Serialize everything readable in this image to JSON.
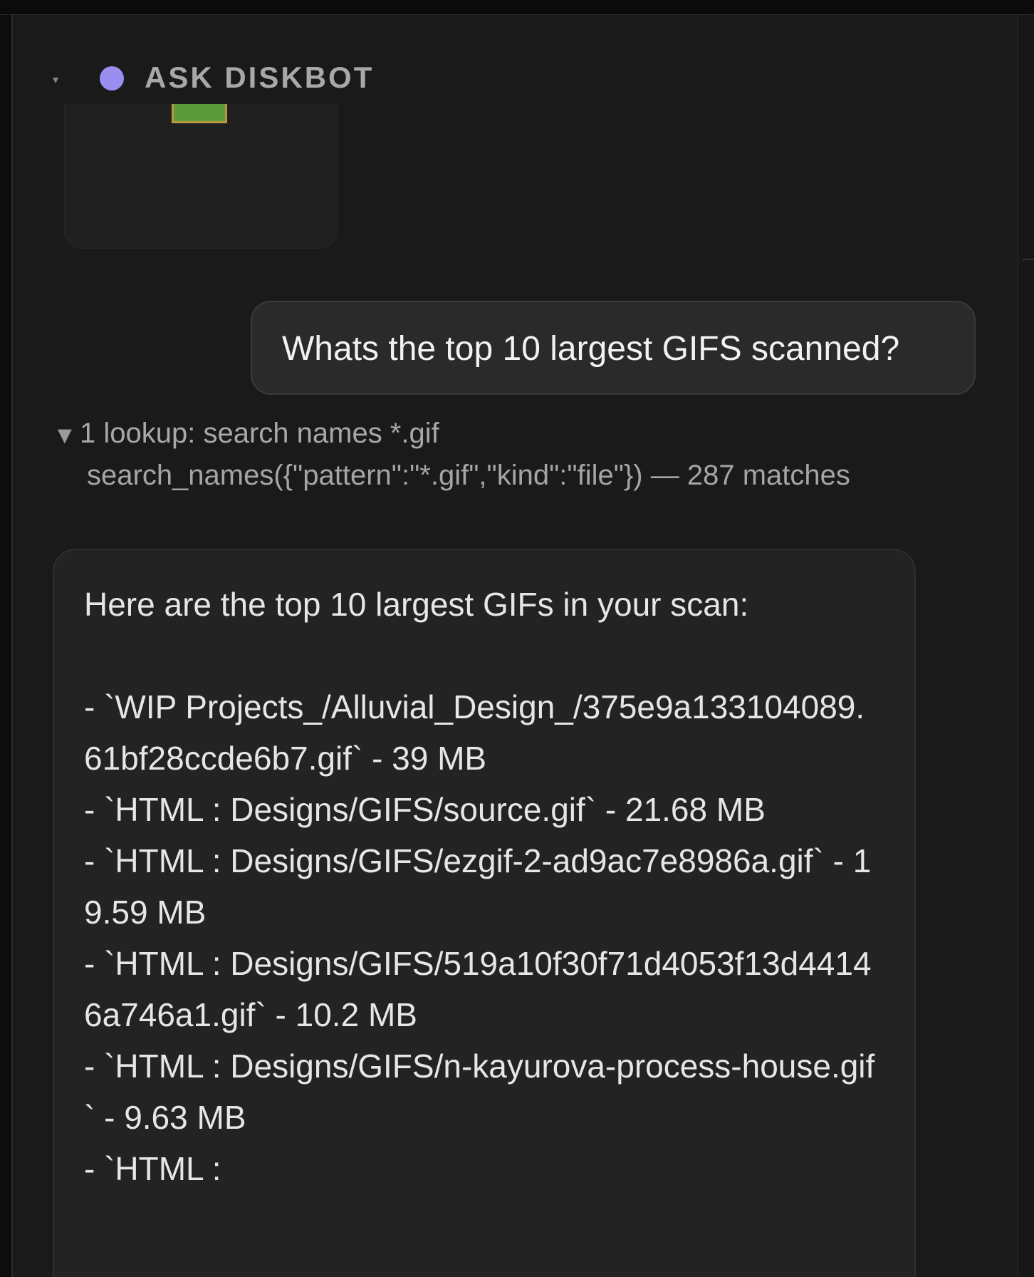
{
  "header": {
    "title": "ASK DISKBOT"
  },
  "conversation": {
    "user_message": "Whats the top 10 largest GIFS scanned?",
    "lookup": {
      "title": "1 lookup: search names *.gif",
      "call": "search_names({\"pattern\":\"*.gif\",\"kind\":\"file\"}) — 287 matches"
    },
    "answer": {
      "intro": "Here are the top 10 largest GIFs in your scan:",
      "items": [
        "- `WIP Projects_/Alluvial_Design_/375e9a133104089.61bf28ccde6b7.gif` - 39 MB",
        "- `HTML : Designs/GIFS/source.gif` - 21.68 MB",
        "- `HTML : Designs/GIFS/ezgif-2-ad9ac7e8986a.gif` - 19.59 MB",
        "- `HTML : Designs/GIFS/519a10f30f71d4053f13d44146a746a1.gif` - 10.2 MB",
        "- `HTML : Designs/GIFS/n-kayurova-process-house.gif` - 9.63 MB",
        "- `HTML :"
      ]
    }
  }
}
